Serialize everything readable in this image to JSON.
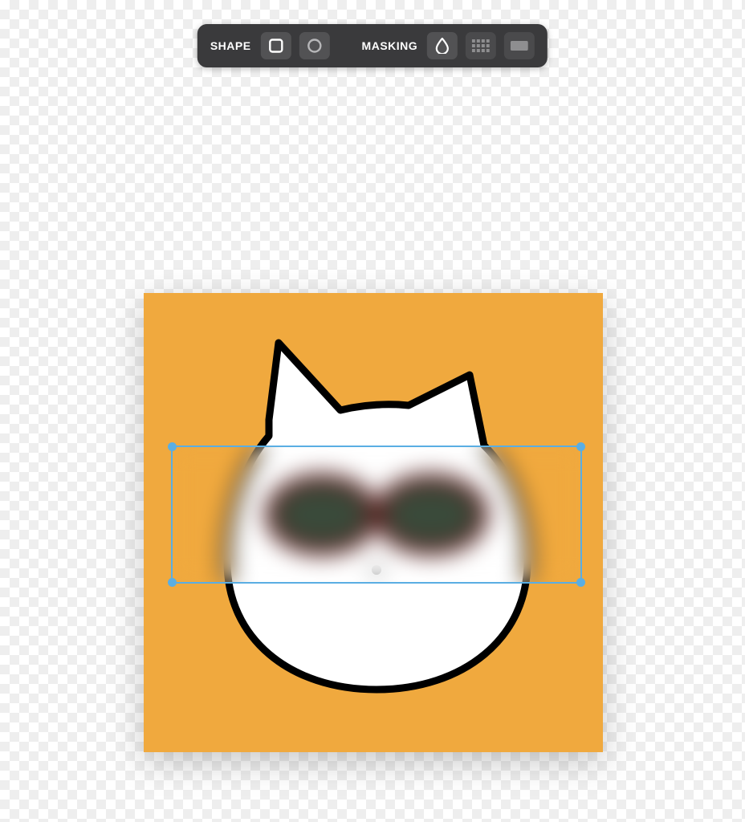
{
  "toolbar": {
    "shape_label": "SHAPE",
    "masking_label": "MASKING",
    "shape_rect": "rectangle-icon",
    "shape_circle": "circle-icon",
    "mask_blur": "blur-icon",
    "mask_pixelate": "pixelate-icon",
    "mask_solid": "solid-icon"
  },
  "canvas": {
    "background_color": "#f0a93e",
    "subject": "cat-with-sunglasses"
  },
  "selection": {
    "shape": "rectangle",
    "mask_effect": "blur",
    "border_color": "#5aaee3"
  }
}
